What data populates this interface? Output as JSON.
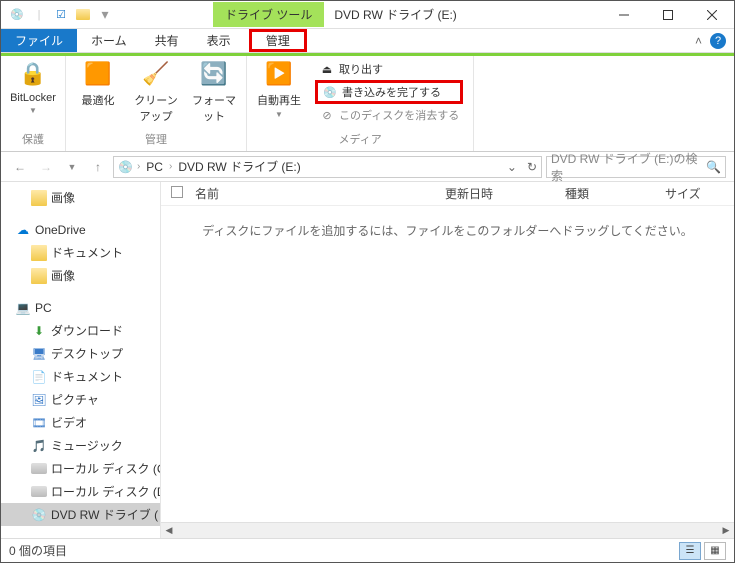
{
  "title": "DVD RW ドライブ (E:)",
  "contextual_tab": "ドライブ ツール",
  "tabs": {
    "file": "ファイル",
    "home": "ホーム",
    "share": "共有",
    "view": "表示",
    "manage": "管理"
  },
  "ribbon": {
    "protect_group": "保護",
    "manage_group": "管理",
    "media_group": "メディア",
    "bitlocker": "BitLocker",
    "optimize": "最適化",
    "cleanup": "クリーンアップ",
    "format": "フォーマット",
    "autoplay": "自動再生",
    "eject": "取り出す",
    "finalize": "書き込みを完了する",
    "erase": "このディスクを消去する"
  },
  "address": {
    "pc": "PC",
    "drive": "DVD RW ドライブ (E:)"
  },
  "search_placeholder": "DVD RW ドライブ (E:)の検索",
  "tree": {
    "images": "画像",
    "onedrive": "OneDrive",
    "documents": "ドキュメント",
    "images2": "画像",
    "pc": "PC",
    "downloads": "ダウンロード",
    "desktop": "デスクトップ",
    "docs": "ドキュメント",
    "pictures": "ピクチャ",
    "videos": "ビデオ",
    "music": "ミュージック",
    "ldc": "ローカル ディスク (C",
    "ldd": "ローカル ディスク (D",
    "dvd": "DVD RW ドライブ ("
  },
  "columns": {
    "name": "名前",
    "date": "更新日時",
    "type": "種類",
    "size": "サイズ"
  },
  "empty_message": "ディスクにファイルを追加するには、ファイルをこのフォルダーへドラッグしてください。",
  "status": "0 個の項目"
}
